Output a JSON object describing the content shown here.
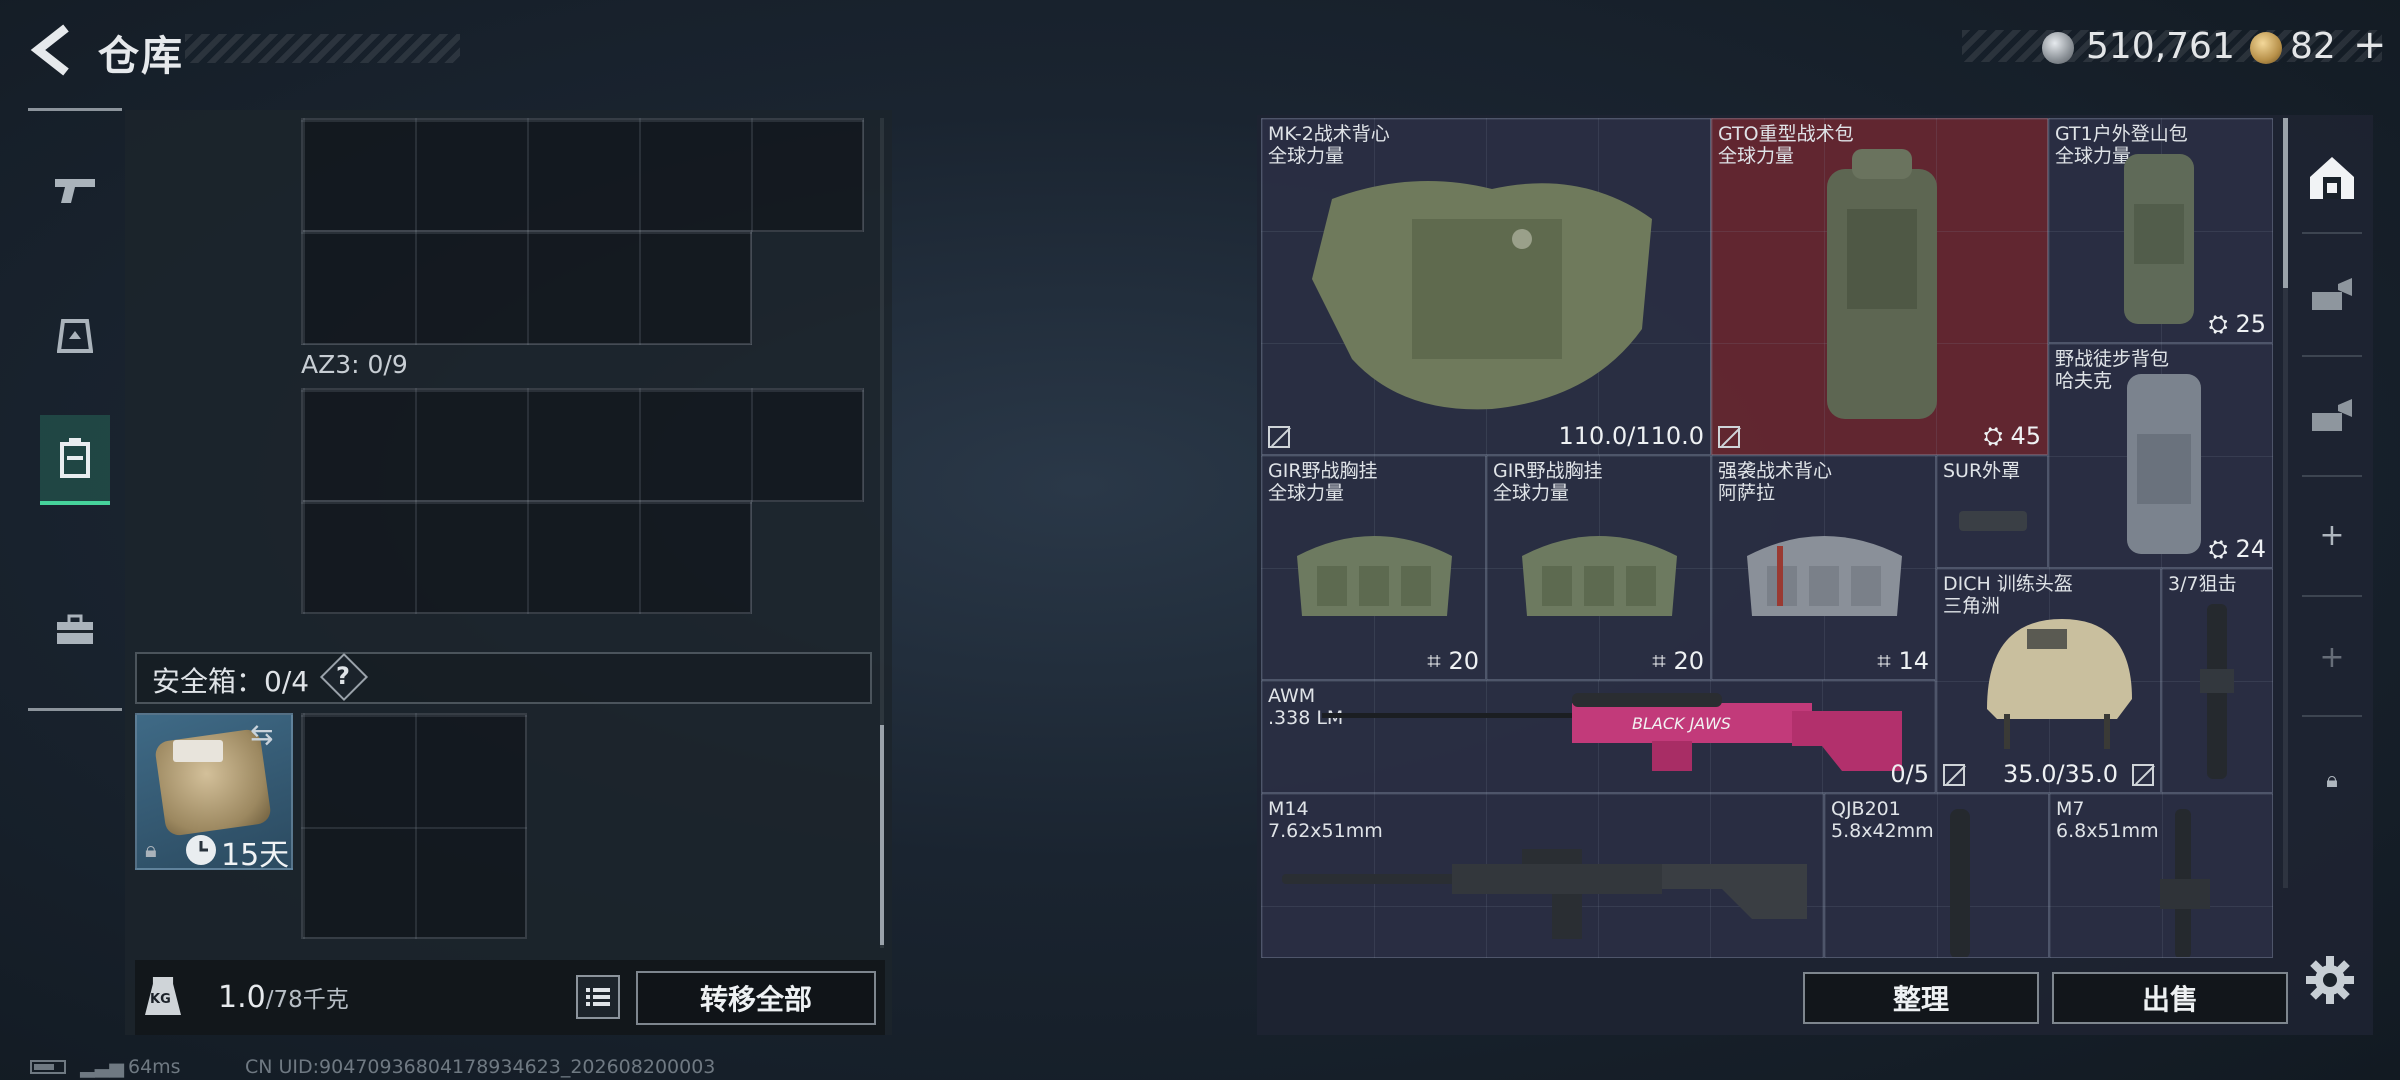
{
  "header": {
    "title": "仓库",
    "coin_silver": "510,761",
    "coin_gold": "82",
    "plus": "+"
  },
  "left_tabs": [
    {
      "name": "weapons-tab",
      "icon": "pistol-icon",
      "active": false
    },
    {
      "name": "gear-tab",
      "icon": "helmet-icon",
      "active": false
    },
    {
      "name": "backpack-tab",
      "icon": "backpack-icon",
      "active": true
    },
    {
      "name": "case-tab",
      "icon": "briefcase-icon",
      "active": false
    }
  ],
  "storage": {
    "az3_label": "AZ3: 0/9",
    "safe_label": "安全箱：0/4",
    "safe_help": "?",
    "safe_case": {
      "days": "15天",
      "icon": "case-icon"
    }
  },
  "footer_left": {
    "weight_value": "1.0",
    "weight_capacity": "/78千克",
    "transfer_all": "转移全部"
  },
  "inventory_items": [
    {
      "name": "MK-2战术背心",
      "sub": "全球力量",
      "value": "110.0/110.0",
      "icon": "vest-icon"
    },
    {
      "name": "GTO重型战术包",
      "sub": "全球力量",
      "value": "45",
      "icon": "backpack-icon",
      "highlight": "#7a2a32"
    },
    {
      "name": "GT1户外登山包",
      "sub": "全球力量",
      "value": "25",
      "icon": "backpack-icon"
    },
    {
      "name": "野战徒步背包",
      "sub": "哈夫克",
      "value": "24",
      "icon": "backpack-icon"
    },
    {
      "name": "GIR野战胸挂",
      "sub": "全球力量",
      "value": "20",
      "icon": "chestrig-icon"
    },
    {
      "name": "GIR野战胸挂",
      "sub": "全球力量",
      "value": "20",
      "icon": "chestrig-icon"
    },
    {
      "name": "强袭战术背心",
      "sub": "阿萨拉",
      "value": "14",
      "icon": "chestrig-icon"
    },
    {
      "name": "SUR外罩",
      "sub": "",
      "value": "",
      "icon": "cover-icon"
    },
    {
      "name": "DICH 训练头盔",
      "sub": "三角洲",
      "value": "35.0/35.0",
      "icon": "helmet-icon"
    },
    {
      "name": "3/7狙击",
      "sub": "",
      "value": "",
      "icon": "scope-icon"
    },
    {
      "name": "AWM",
      "sub": ".338 LM",
      "value": "0/5",
      "icon": "sniper-rifle-icon",
      "skin_text": "BLACK JAWS"
    },
    {
      "name": "M14",
      "sub": "7.62x51mm",
      "value": "",
      "icon": "rifle-icon"
    },
    {
      "name": "QJB201",
      "sub": "5.8x42mm",
      "value": "",
      "icon": "suppressor-icon"
    },
    {
      "name": "M7",
      "sub": "6.8x51mm",
      "value": "",
      "icon": "suppressor-icon"
    }
  ],
  "footer_right": {
    "sort": "整理",
    "sell": "出售"
  },
  "right_icons": [
    "warehouse-icon",
    "crafting-icon",
    "crafting-icon",
    "add-icon",
    "add-icon",
    "lock-icon",
    "settings-icon"
  ],
  "status_bar": {
    "ping": "64ms",
    "uid": "CN UID:9047093680417893462​3_202608200003"
  },
  "colors": {
    "accent": "#46d39b",
    "highlight_cell": "#7a2a32",
    "panel": "#1e2432"
  }
}
